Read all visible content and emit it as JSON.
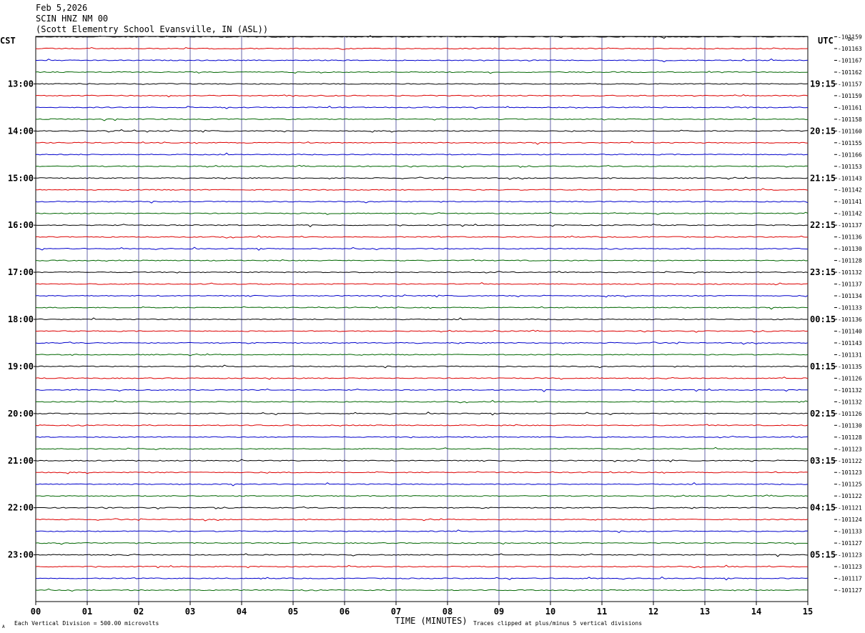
{
  "header": {
    "date": "Feb 5,2026",
    "station": "SCIN HNZ NM 00",
    "location": "(Scott Elementry School Evansville, IN (ASL))"
  },
  "axis_labels": {
    "left_timezone": "CST",
    "right_timezone": "UTC",
    "dc_label": "DC",
    "xlabel": "TIME (MINUTES)",
    "footer_left": "Each Vertical Division =  500.00 microvolts",
    "footer_right": "Traces clipped at plus/minus 5 vertical divisions",
    "corner_mark": "A"
  },
  "colors": {
    "trace_cycle": [
      "#000000",
      "#dd0000",
      "#0000cc",
      "#006600"
    ],
    "grid_vertical": "#6666aa",
    "frame": "#000000"
  },
  "chart_data": {
    "type": "line",
    "title": "SCIN HNZ NM 00",
    "xlabel": "TIME (MINUTES)",
    "xlim": [
      0,
      15
    ],
    "x_ticks": [
      "00",
      "01",
      "02",
      "03",
      "04",
      "05",
      "06",
      "07",
      "08",
      "09",
      "10",
      "11",
      "12",
      "13",
      "14",
      "15"
    ],
    "trace_count": 48,
    "trace_minutes": 15,
    "cst_hour_labels": [
      "13:00",
      "14:00",
      "15:00",
      "16:00",
      "17:00",
      "18:00",
      "19:00",
      "20:00",
      "21:00",
      "22:00",
      "23:00"
    ],
    "utc_hour_labels": [
      "19:15",
      "20:15",
      "21:15",
      "22:15",
      "23:15",
      "00:15",
      "01:15",
      "02:15",
      "03:15",
      "04:15",
      "05:15"
    ],
    "dc_offsets": [
      "-101159",
      "-101163",
      "-101167",
      "-101162",
      "-101157",
      "-101159",
      "-101161",
      "-101158",
      "-101160",
      "-101155",
      "-101166",
      "-101153",
      "-101143",
      "-101142",
      "-101141",
      "-101142",
      "-101137",
      "-101136",
      "-101130",
      "-101128",
      "-101132",
      "-101137",
      "-101134",
      "-101133",
      "-101136",
      "-101140",
      "-101143",
      "-101131",
      "-101135",
      "-101126",
      "-101132",
      "-101132",
      "-101126",
      "-101130",
      "-101128",
      "-101123",
      "-101122",
      "-101123",
      "-101125",
      "-101122",
      "-101121",
      "-101124",
      "-101133",
      "-101127",
      "-101123",
      "-101123",
      "-101117",
      "-101127"
    ],
    "vertical_division_microvolts": 500,
    "clip_divisions": 5
  }
}
